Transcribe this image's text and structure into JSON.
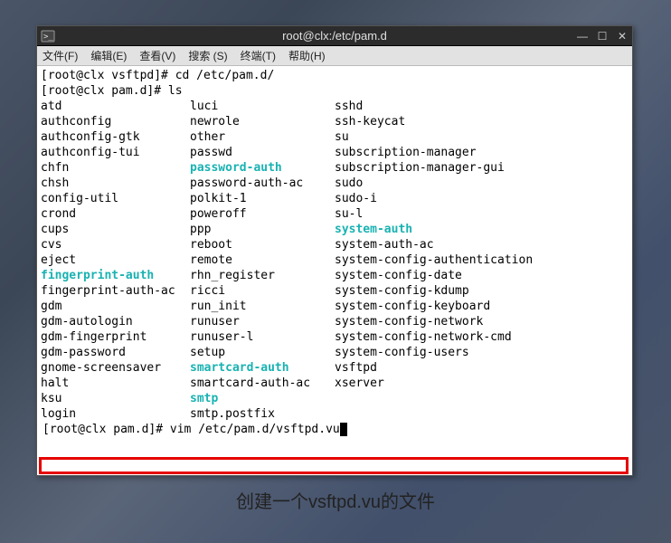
{
  "titlebar": {
    "title": "root@clx:/etc/pam.d"
  },
  "controls": {
    "min": "—",
    "max": "☐",
    "close": "✕"
  },
  "menubar": {
    "file": "文件(F)",
    "edit": "编辑(E)",
    "view": "查看(V)",
    "search": "搜索 (S)",
    "terminal": "终端(T)",
    "help": "帮助(H)"
  },
  "prompt1": "[root@clx vsftpd]# cd /etc/pam.d/",
  "prompt2": "[root@clx pam.d]# ls",
  "listing": [
    {
      "c1": "atd",
      "c2": "luci",
      "c3": "sshd"
    },
    {
      "c1": "authconfig",
      "c2": "newrole",
      "c3": "ssh-keycat"
    },
    {
      "c1": "authconfig-gtk",
      "c2": "other",
      "c3": "su"
    },
    {
      "c1": "authconfig-tui",
      "c2": "passwd",
      "c3": "subscription-manager"
    },
    {
      "c1": "chfn",
      "c2": "password-auth",
      "c2teal": true,
      "c3": "subscription-manager-gui"
    },
    {
      "c1": "chsh",
      "c2": "password-auth-ac",
      "c3": "sudo"
    },
    {
      "c1": "config-util",
      "c2": "polkit-1",
      "c3": "sudo-i"
    },
    {
      "c1": "crond",
      "c2": "poweroff",
      "c3": "su-l"
    },
    {
      "c1": "cups",
      "c2": "ppp",
      "c3": "system-auth",
      "c3teal": true
    },
    {
      "c1": "cvs",
      "c2": "reboot",
      "c3": "system-auth-ac"
    },
    {
      "c1": "eject",
      "c2": "remote",
      "c3": "system-config-authentication"
    },
    {
      "c1": "fingerprint-auth",
      "c1teal": true,
      "c2": "rhn_register",
      "c3": "system-config-date"
    },
    {
      "c1": "fingerprint-auth-ac",
      "c2": "ricci",
      "c3": "system-config-kdump"
    },
    {
      "c1": "gdm",
      "c2": "run_init",
      "c3": "system-config-keyboard"
    },
    {
      "c1": "gdm-autologin",
      "c2": "runuser",
      "c3": "system-config-network"
    },
    {
      "c1": "gdm-fingerprint",
      "c2": "runuser-l",
      "c3": "system-config-network-cmd"
    },
    {
      "c1": "gdm-password",
      "c2": "setup",
      "c3": "system-config-users"
    },
    {
      "c1": "gnome-screensaver",
      "c2": "smartcard-auth",
      "c2teal": true,
      "c3": "vsftpd"
    },
    {
      "c1": "halt",
      "c2": "smartcard-auth-ac",
      "c3": "xserver"
    },
    {
      "c1": "ksu",
      "c2": "smtp",
      "c2teal": true,
      "c3": ""
    },
    {
      "c1": "login",
      "c2": "smtp.postfix",
      "c3": ""
    }
  ],
  "cmdline": {
    "prompt": "[root@clx pam.d]# ",
    "command": "vim /etc/pam.d/vsftpd.vu"
  },
  "caption": "创建一个vsftpd.vu的文件"
}
